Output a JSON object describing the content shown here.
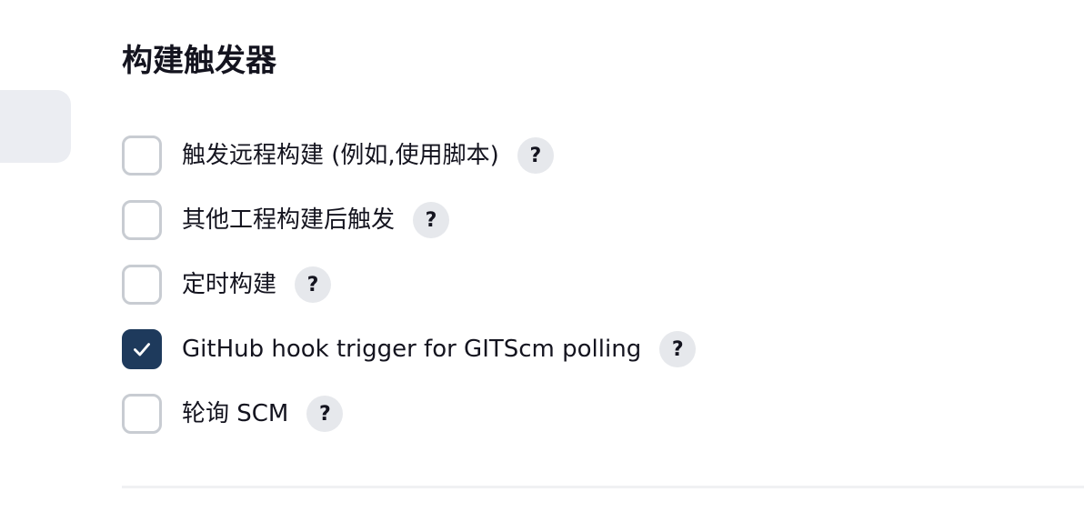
{
  "section": {
    "title": "构建触发器"
  },
  "triggers": [
    {
      "label": "触发远程构建 (例如,使用脚本)",
      "checked": false,
      "help": "?"
    },
    {
      "label": "其他工程构建后触发",
      "checked": false,
      "help": "?"
    },
    {
      "label": "定时构建",
      "checked": false,
      "help": "?"
    },
    {
      "label": "GitHub hook trigger for GITScm polling",
      "checked": true,
      "help": "?"
    },
    {
      "label": "轮询 SCM",
      "checked": false,
      "help": "?"
    }
  ],
  "colors": {
    "checked_fill": "#1e3a5c",
    "checkbox_border": "#c8ccd2",
    "help_bg": "#e6e8ec",
    "side_tab_bg": "#ebedf2"
  },
  "icons": {
    "check": "checkmark-icon",
    "help": "question-mark-icon"
  }
}
